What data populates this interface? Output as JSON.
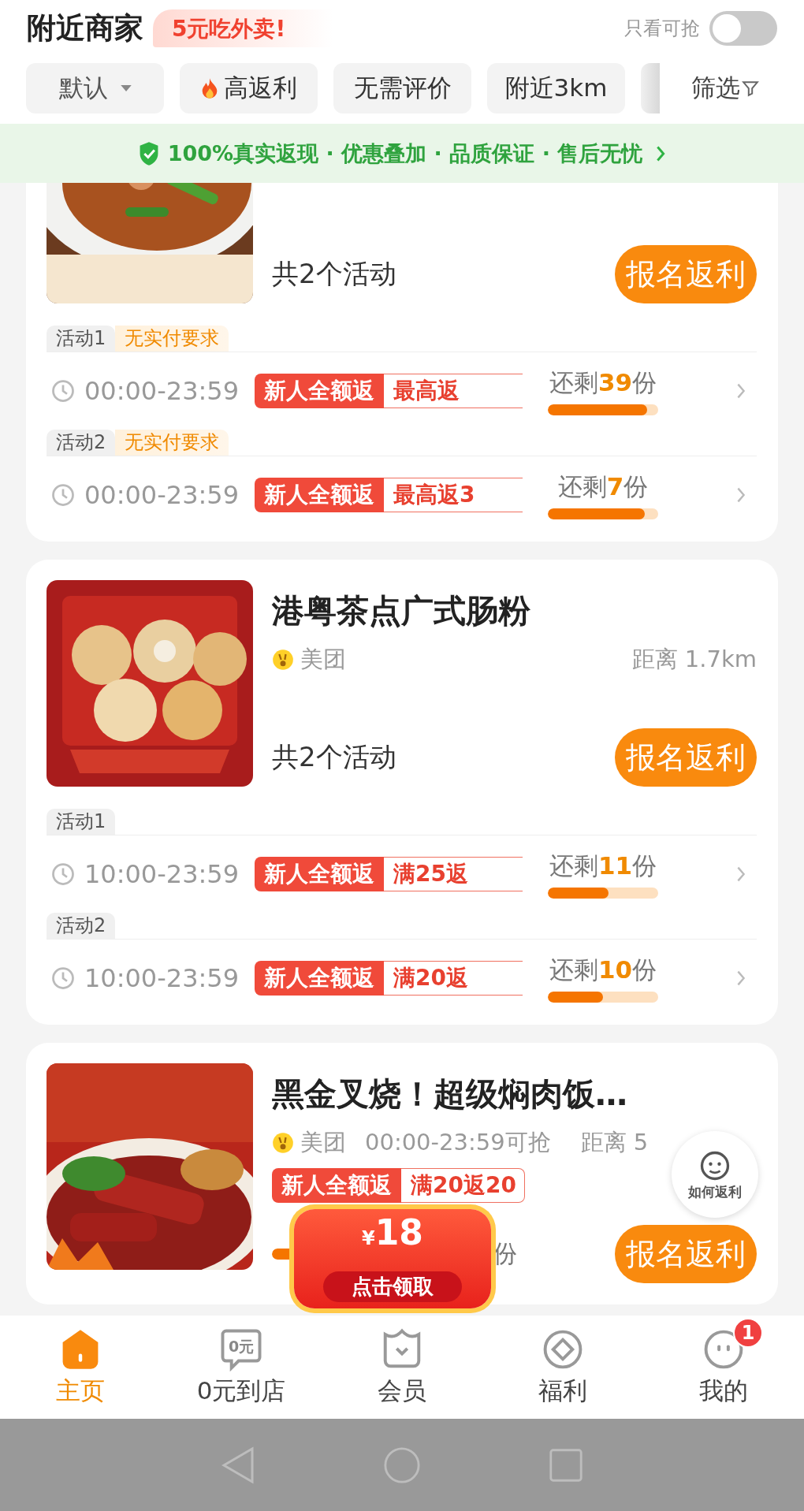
{
  "header": {
    "title": "附近商家",
    "promo": "5元吃外卖!",
    "toggle_label": "只看可抢",
    "toggle_on": false
  },
  "filters": [
    {
      "label": "默认",
      "kind": "dropdown"
    },
    {
      "label": "高返利",
      "kind": "hot"
    },
    {
      "label": "无需评价",
      "kind": "plain"
    },
    {
      "label": "附近3km",
      "kind": "plain"
    },
    {
      "label": "筛选",
      "kind": "filter"
    }
  ],
  "banner": {
    "text": "100%真实返现 · 优惠叠加 · 品质保证 · 售后无忧"
  },
  "shops": [
    {
      "kind": "activities",
      "count": "共2个活动",
      "button": "报名返利",
      "activities": [
        {
          "label": "活动1",
          "tag": "无实付要求",
          "time": "00:00-23:59",
          "badge": "新人全额返",
          "offer": "最高返",
          "remaining_prefix": "还剩",
          "remaining": "39",
          "remaining_suffix": "份",
          "level": 0.9
        },
        {
          "label": "活动2",
          "tag": "无实付要求",
          "time": "00:00-23:59",
          "badge": "新人全额返",
          "offer": "最高返3",
          "remaining_prefix": "还剩",
          "remaining": "7",
          "remaining_suffix": "份",
          "level": 0.88
        }
      ]
    },
    {
      "kind": "activities",
      "name": "港粤茶点广式肠粉",
      "platform": "美团",
      "distance": "距离 1.7km",
      "count": "共2个活动",
      "button": "报名返利",
      "activities": [
        {
          "label": "活动1",
          "time": "10:00-23:59",
          "badge": "新人全额返",
          "offer": "满25返",
          "remaining_prefix": "还剩",
          "remaining": "11",
          "remaining_suffix": "份",
          "level": 0.55
        },
        {
          "label": "活动2",
          "time": "10:00-23:59",
          "badge": "新人全额返",
          "offer": "满20返",
          "remaining_prefix": "还剩",
          "remaining": "10",
          "remaining_suffix": "份",
          "level": 0.5
        }
      ]
    },
    {
      "kind": "single",
      "name": "黑金叉烧！超级焖肉饭…",
      "platform": "美团",
      "hours": "00:00-23:59可抢",
      "distance": "距离 5",
      "badge": "新人全额返",
      "offer": "满20返20",
      "remaining_suffix": "份",
      "level": 0.12,
      "button": "报名返利",
      "coupon": {
        "currency": "¥",
        "amount": "18",
        "action": "点击领取"
      }
    }
  ],
  "help_button": {
    "label": "如何返利"
  },
  "nav": [
    {
      "label": "主页",
      "kind": "home",
      "selected": true
    },
    {
      "label": "0元到店",
      "kind": "store",
      "icon_text": "0元",
      "selected": false
    },
    {
      "label": "会员",
      "kind": "member",
      "selected": false
    },
    {
      "label": "福利",
      "kind": "welfare",
      "selected": false
    },
    {
      "label": "我的",
      "kind": "me",
      "selected": false,
      "badge": "1"
    }
  ]
}
